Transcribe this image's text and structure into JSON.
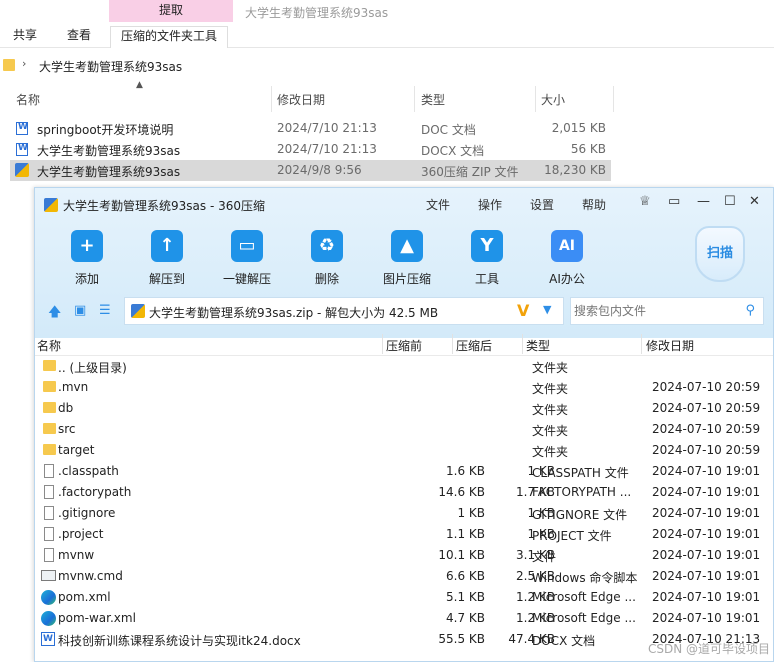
{
  "explorer": {
    "context_tab": "提取",
    "window_title": "大学生考勤管理系统93sas",
    "ribbon_tabs": [
      "共享",
      "查看",
      "压缩的文件夹工具"
    ],
    "breadcrumb": "大学生考勤管理系统93sas",
    "columns": [
      "名称",
      "修改日期",
      "类型",
      "大小"
    ],
    "files": [
      {
        "name": "springboot开发环境说明",
        "date": "2024/7/10 21:13",
        "type": "DOC 文档",
        "size": "2,015 KB",
        "icon": "word-doc-icon",
        "selected": false
      },
      {
        "name": "大学生考勤管理系统93sas",
        "date": "2024/7/10 21:13",
        "type": "DOCX 文档",
        "size": "56 KB",
        "icon": "word-doc-icon",
        "selected": false
      },
      {
        "name": "大学生考勤管理系统93sas",
        "date": "2024/9/8 9:56",
        "type": "360压缩 ZIP 文件",
        "size": "18,230 KB",
        "icon": "zip-archive-icon",
        "selected": true
      }
    ]
  },
  "zip": {
    "title": "大学生考勤管理系统93sas - 360压缩",
    "menu": [
      "文件",
      "操作",
      "设置",
      "帮助"
    ],
    "window_controls": [
      "feedback",
      "skin",
      "minimize",
      "maximize",
      "close"
    ],
    "tools": [
      {
        "label": "添加",
        "icon": "add-icon",
        "glyph": "+"
      },
      {
        "label": "解压到",
        "icon": "extract-to-icon",
        "glyph": "↑"
      },
      {
        "label": "一键解压",
        "icon": "one-click-extract-icon",
        "glyph": "▭"
      },
      {
        "label": "删除",
        "icon": "delete-icon",
        "glyph": "♻"
      },
      {
        "label": "图片压缩",
        "icon": "image-compress-icon",
        "glyph": "▲"
      },
      {
        "label": "工具",
        "icon": "tools-icon",
        "glyph": "Y"
      },
      {
        "label": "AI办公",
        "icon": "ai-office-icon",
        "glyph": "AI"
      }
    ],
    "scan_label": "扫描",
    "path": "大学生考勤管理系统93sas.zip - 解包大小为 42.5 MB",
    "search_placeholder": "搜索包内文件",
    "columns": [
      "名称",
      "压缩前",
      "压缩后",
      "类型",
      "修改日期"
    ],
    "rows": [
      {
        "name": ".. (上级目录)",
        "csize": "",
        "usize": "",
        "type": "文件夹",
        "date": "",
        "icon": "folder"
      },
      {
        "name": ".mvn",
        "csize": "",
        "usize": "",
        "type": "文件夹",
        "date": "2024-07-10 20:59",
        "icon": "folder"
      },
      {
        "name": "db",
        "csize": "",
        "usize": "",
        "type": "文件夹",
        "date": "2024-07-10 20:59",
        "icon": "folder"
      },
      {
        "name": "src",
        "csize": "",
        "usize": "",
        "type": "文件夹",
        "date": "2024-07-10 20:59",
        "icon": "folder"
      },
      {
        "name": "target",
        "csize": "",
        "usize": "",
        "type": "文件夹",
        "date": "2024-07-10 20:59",
        "icon": "folder"
      },
      {
        "name": ".classpath",
        "csize": "1.6 KB",
        "usize": "1 KB",
        "type": "CLASSPATH 文件",
        "date": "2024-07-10 19:01",
        "icon": "doc"
      },
      {
        "name": ".factorypath",
        "csize": "14.6 KB",
        "usize": "1.7 KB",
        "type": "FACTORYPATH ...",
        "date": "2024-07-10 19:01",
        "icon": "doc"
      },
      {
        "name": ".gitignore",
        "csize": "1 KB",
        "usize": "1 KB",
        "type": "GITIGNORE 文件",
        "date": "2024-07-10 19:01",
        "icon": "doc"
      },
      {
        "name": ".project",
        "csize": "1.1 KB",
        "usize": "1 KB",
        "type": "PROJECT 文件",
        "date": "2024-07-10 19:01",
        "icon": "doc"
      },
      {
        "name": "mvnw",
        "csize": "10.1 KB",
        "usize": "3.1 KB",
        "type": "文件",
        "date": "2024-07-10 19:01",
        "icon": "doc"
      },
      {
        "name": "mvnw.cmd",
        "csize": "6.6 KB",
        "usize": "2.5 KB",
        "type": "Windows 命令脚本",
        "date": "2024-07-10 19:01",
        "icon": "cmd"
      },
      {
        "name": "pom.xml",
        "csize": "5.1 KB",
        "usize": "1.2 KB",
        "type": "Microsoft Edge ...",
        "date": "2024-07-10 19:01",
        "icon": "edge"
      },
      {
        "name": "pom-war.xml",
        "csize": "4.7 KB",
        "usize": "1.2 KB",
        "type": "Microsoft Edge ...",
        "date": "2024-07-10 19:01",
        "icon": "edge"
      },
      {
        "name": "科技创新训练课程系统设计与实现itk24.docx",
        "csize": "55.5 KB",
        "usize": "47.4 KB",
        "type": "DOCX 文档",
        "date": "2024-07-10 21:13",
        "icon": "word"
      }
    ]
  },
  "watermark": "CSDN @道可毕设项目"
}
